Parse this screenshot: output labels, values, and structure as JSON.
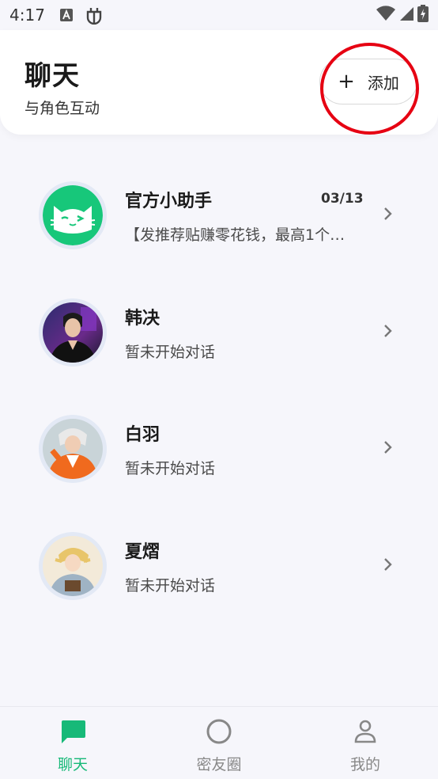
{
  "status_bar": {
    "time": "4:17"
  },
  "header": {
    "title": "聊天",
    "subtitle": "与角色互动",
    "add_button": {
      "plus": "+",
      "label": "添加"
    }
  },
  "chats": [
    {
      "name": "官方小助手",
      "date": "03/13",
      "preview": "【发推荐贴赚零花钱，最高1个…",
      "avatar_icon": "cat-mascot-icon"
    },
    {
      "name": "韩决",
      "date": "",
      "preview": "暂未开始对话",
      "avatar_icon": "character-portrait"
    },
    {
      "name": "白羽",
      "date": "",
      "preview": "暂未开始对话",
      "avatar_icon": "character-portrait"
    },
    {
      "name": "夏熠",
      "date": "",
      "preview": "暂未开始对话",
      "avatar_icon": "character-portrait"
    }
  ],
  "tabs": [
    {
      "label": "聊天",
      "icon": "chat-bubble-icon",
      "active": true
    },
    {
      "label": "密友圈",
      "icon": "circle-icon",
      "active": false
    },
    {
      "label": "我的",
      "icon": "person-icon",
      "active": false
    }
  ],
  "colors": {
    "accent": "#17b978",
    "background": "#f6f6fb",
    "annotation": "#e60012"
  }
}
